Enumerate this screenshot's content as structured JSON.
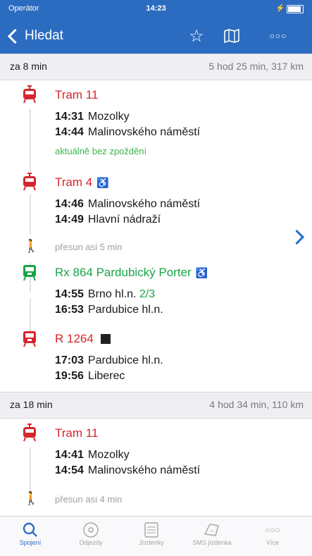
{
  "status_bar": {
    "carrier": "Operátor",
    "time": "14:23"
  },
  "navbar": {
    "back_label": "Hledat",
    "icons": [
      "star-icon",
      "map-icon",
      "more-icon"
    ]
  },
  "connections": [
    {
      "header_left": "za 8 min",
      "header_right": "5 hod 25 min, 317 km",
      "legs": [
        {
          "type": "tram",
          "title": "Tram 11",
          "stops": [
            {
              "time": "14:31",
              "name": "Mozolky"
            },
            {
              "time": "14:44",
              "name": "Malinovského náměstí"
            }
          ],
          "note": "aktuálně bez zpoždění"
        },
        {
          "type": "tram",
          "title": "Tram 4",
          "accessible": true,
          "stops": [
            {
              "time": "14:46",
              "name": "Malinovského náměstí"
            },
            {
              "time": "14:49",
              "name": "Hlavní nádraží"
            }
          ]
        },
        {
          "type": "walk",
          "text": "přesun asi 5 min"
        },
        {
          "type": "train-green",
          "title": "Rx 864 Pardubický Porter",
          "accessible": true,
          "stops": [
            {
              "time": "14:55",
              "name": "Brno hl.n.",
              "platform": "2/3"
            },
            {
              "time": "16:53",
              "name": "Pardubice hl.n."
            }
          ]
        },
        {
          "type": "train-red",
          "title": "R 1264",
          "accessible_dark": true,
          "stops": [
            {
              "time": "17:03",
              "name": "Pardubice hl.n."
            },
            {
              "time": "19:56",
              "name": "Liberec"
            }
          ]
        }
      ]
    },
    {
      "header_left": "za 18 min",
      "header_right": "4 hod 34 min, 110 km",
      "legs": [
        {
          "type": "tram",
          "title": "Tram 11",
          "stops": [
            {
              "time": "14:41",
              "name": "Mozolky"
            },
            {
              "time": "14:54",
              "name": "Malinovského náměstí"
            }
          ]
        },
        {
          "type": "walk",
          "text": "přesun asi 4 min"
        }
      ]
    }
  ],
  "tabbar": [
    {
      "label": "Spojení",
      "icon": "search-icon",
      "active": true
    },
    {
      "label": "Odjezdy",
      "icon": "departures-icon",
      "active": false
    },
    {
      "label": "Jízdenky",
      "icon": "ticket-icon",
      "active": false
    },
    {
      "label": "SMS jízdenka",
      "icon": "sms-ticket-icon",
      "active": false
    },
    {
      "label": "Více",
      "icon": "more-icon",
      "active": false
    }
  ],
  "colors": {
    "primary": "#2c6cc0",
    "red": "#d4262c",
    "green": "#1aa347",
    "note_green": "#3bb54a"
  }
}
